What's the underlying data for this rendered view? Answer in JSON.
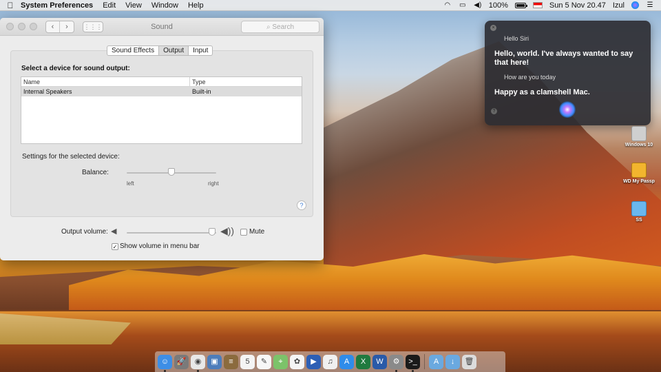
{
  "menubar": {
    "apple_icon": "apple-icon",
    "app_name": "System Preferences",
    "menus": [
      "Edit",
      "View",
      "Window",
      "Help"
    ],
    "battery_percent": "100%",
    "date_time": "Sun 5 Nov  20.47",
    "user": "Izul"
  },
  "window": {
    "title": "Sound",
    "search_placeholder": "Search",
    "tabs": [
      {
        "label": "Sound Effects",
        "selected": false
      },
      {
        "label": "Output",
        "selected": true
      },
      {
        "label": "Input",
        "selected": false
      }
    ],
    "panel": {
      "heading": "Select a device for sound output:",
      "columns": [
        "Name",
        "Type"
      ],
      "rows": [
        {
          "name": "Internal Speakers",
          "type": "Built-in"
        }
      ],
      "settings_label": "Settings for the selected device:",
      "balance_label": "Balance:",
      "balance_left": "left",
      "balance_right": "right",
      "balance_value": 0.5,
      "help": "?"
    },
    "output_volume_label": "Output volume:",
    "output_volume_value": 0.95,
    "mute_label": "Mute",
    "mute_checked": false,
    "show_volume_label": "Show volume in menu bar",
    "show_volume_checked": true
  },
  "siri": {
    "q1": "Hello Siri",
    "a1": "Hello, world. I've always wanted to say that here!",
    "q2": "How are you today",
    "a2": "Happy as a clamshell Mac."
  },
  "desktop_icons": [
    {
      "label": "Windows 10",
      "icon": "drive-icon",
      "color": "#cfcfcf"
    },
    {
      "label": "WD My Passp",
      "icon": "external-drive-icon",
      "color": "#f2b52e"
    },
    {
      "label": "SS",
      "icon": "folder-icon",
      "color": "#6ab7ee"
    }
  ],
  "dock": [
    {
      "name": "finder",
      "color": "#3d8ee6",
      "glyph": "☺",
      "running": true
    },
    {
      "name": "launchpad",
      "color": "#7a7a7a",
      "glyph": "🚀",
      "running": false
    },
    {
      "name": "chrome",
      "color": "#e8e8e8",
      "glyph": "◉",
      "running": true
    },
    {
      "name": "preview",
      "color": "#4d7dbb",
      "glyph": "▣",
      "running": false
    },
    {
      "name": "notes",
      "color": "#8b6b3e",
      "glyph": "≡",
      "running": false
    },
    {
      "name": "calendar",
      "color": "#f4f4f4",
      "glyph": "5",
      "running": false
    },
    {
      "name": "textedit",
      "color": "#f7f7f7",
      "glyph": "✎",
      "running": false
    },
    {
      "name": "maps",
      "color": "#7cc36a",
      "glyph": "⌖",
      "running": false
    },
    {
      "name": "photos",
      "color": "#f5f5f5",
      "glyph": "✿",
      "running": false
    },
    {
      "name": "keynote",
      "color": "#2d5fb5",
      "glyph": "▶",
      "running": false
    },
    {
      "name": "itunes",
      "color": "#f0f0f0",
      "glyph": "♫",
      "running": false
    },
    {
      "name": "app-store",
      "color": "#2f8cea",
      "glyph": "A",
      "running": false
    },
    {
      "name": "excel",
      "color": "#1f7a3f",
      "glyph": "X",
      "running": false
    },
    {
      "name": "word",
      "color": "#2a5aa8",
      "glyph": "W",
      "running": false
    },
    {
      "name": "system-preferences",
      "color": "#8a8a8a",
      "glyph": "⚙",
      "running": true
    },
    {
      "name": "terminal",
      "color": "#1a1a1a",
      "glyph": ">_",
      "running": true
    },
    {
      "name": "applications-folder",
      "color": "#6aa9e0",
      "glyph": "A",
      "running": false
    },
    {
      "name": "downloads-folder",
      "color": "#6aa9e0",
      "glyph": "↓",
      "running": false
    },
    {
      "name": "trash",
      "color": "#dcdcdc",
      "glyph": "🗑",
      "running": false
    }
  ]
}
